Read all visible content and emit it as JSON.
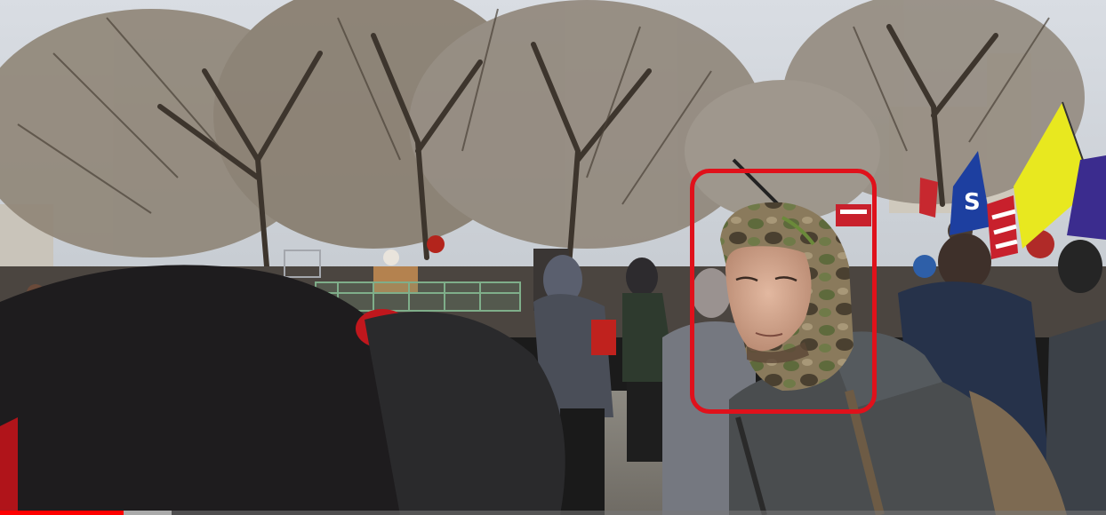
{
  "video": {
    "progress_fraction": 0.112,
    "buffered_fraction": 0.155,
    "progress_color": "#ff0000",
    "highlight_color": "#e0111b"
  },
  "scene": {
    "flag_text": "S"
  }
}
